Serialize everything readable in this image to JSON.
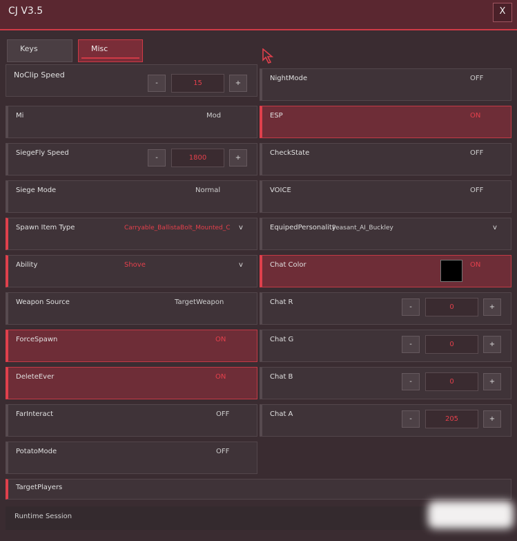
{
  "window": {
    "title": "CJ V3.5",
    "close_label": "X"
  },
  "tabs": [
    {
      "label": "Keys"
    },
    {
      "label": "Misc"
    }
  ],
  "left": {
    "noclip": {
      "label": "NoClip Speed",
      "minus": "-",
      "value": "15",
      "plus": "+"
    },
    "mi": {
      "label": "Mi",
      "value": "Mod"
    },
    "siegefly": {
      "label": "SiegeFly Speed",
      "minus": "-",
      "value": "1800",
      "plus": "+"
    },
    "siege_mode": {
      "label": "Siege Mode",
      "value": "Normal"
    },
    "spawn_item": {
      "label": "Spawn Item Type",
      "value": "Carryable_BallistaBolt_Mounted_C",
      "arrow": "v"
    },
    "ability": {
      "label": "Ability",
      "value": "Shove",
      "arrow": "v"
    },
    "weapon_source": {
      "label": "Weapon Source",
      "value": "TargetWeapon"
    },
    "force_spawn": {
      "label": "ForceSpawn",
      "value": "ON"
    },
    "delete_ever": {
      "label": "DeleteEver",
      "value": "ON"
    },
    "far_interact": {
      "label": "FarInteract",
      "value": "OFF"
    },
    "potato_mode": {
      "label": "PotatoMode",
      "value": "OFF"
    }
  },
  "right": {
    "night_mode": {
      "label": "NightMode",
      "value": "OFF"
    },
    "esp": {
      "label": "ESP",
      "value": "ON"
    },
    "check_state": {
      "label": "CheckState",
      "value": "OFF"
    },
    "voice": {
      "label": "VOICE",
      "value": "OFF"
    },
    "equiped_personality": {
      "label": "EquipedPersonality",
      "value": "Peasant_AI_Buckley",
      "arrow": "v"
    },
    "chat_color": {
      "label": "Chat Color",
      "value": "ON",
      "swatch_color": "#000000"
    },
    "chat_r": {
      "label": "Chat R",
      "minus": "-",
      "value": "0",
      "plus": "+"
    },
    "chat_g": {
      "label": "Chat G",
      "minus": "-",
      "value": "0",
      "plus": "+"
    },
    "chat_b": {
      "label": "Chat B",
      "minus": "-",
      "value": "0",
      "plus": "+"
    },
    "chat_a": {
      "label": "Chat A",
      "minus": "-",
      "value": "205",
      "plus": "+"
    }
  },
  "target_players": {
    "label": "TargetPlayers"
  },
  "footer": {
    "label": "Runtime Session"
  },
  "colors": {
    "accent": "#d03a46",
    "on_bg": "#6e2d37",
    "panel_bg": "#3f3338",
    "window_bg": "#3a2c31"
  }
}
